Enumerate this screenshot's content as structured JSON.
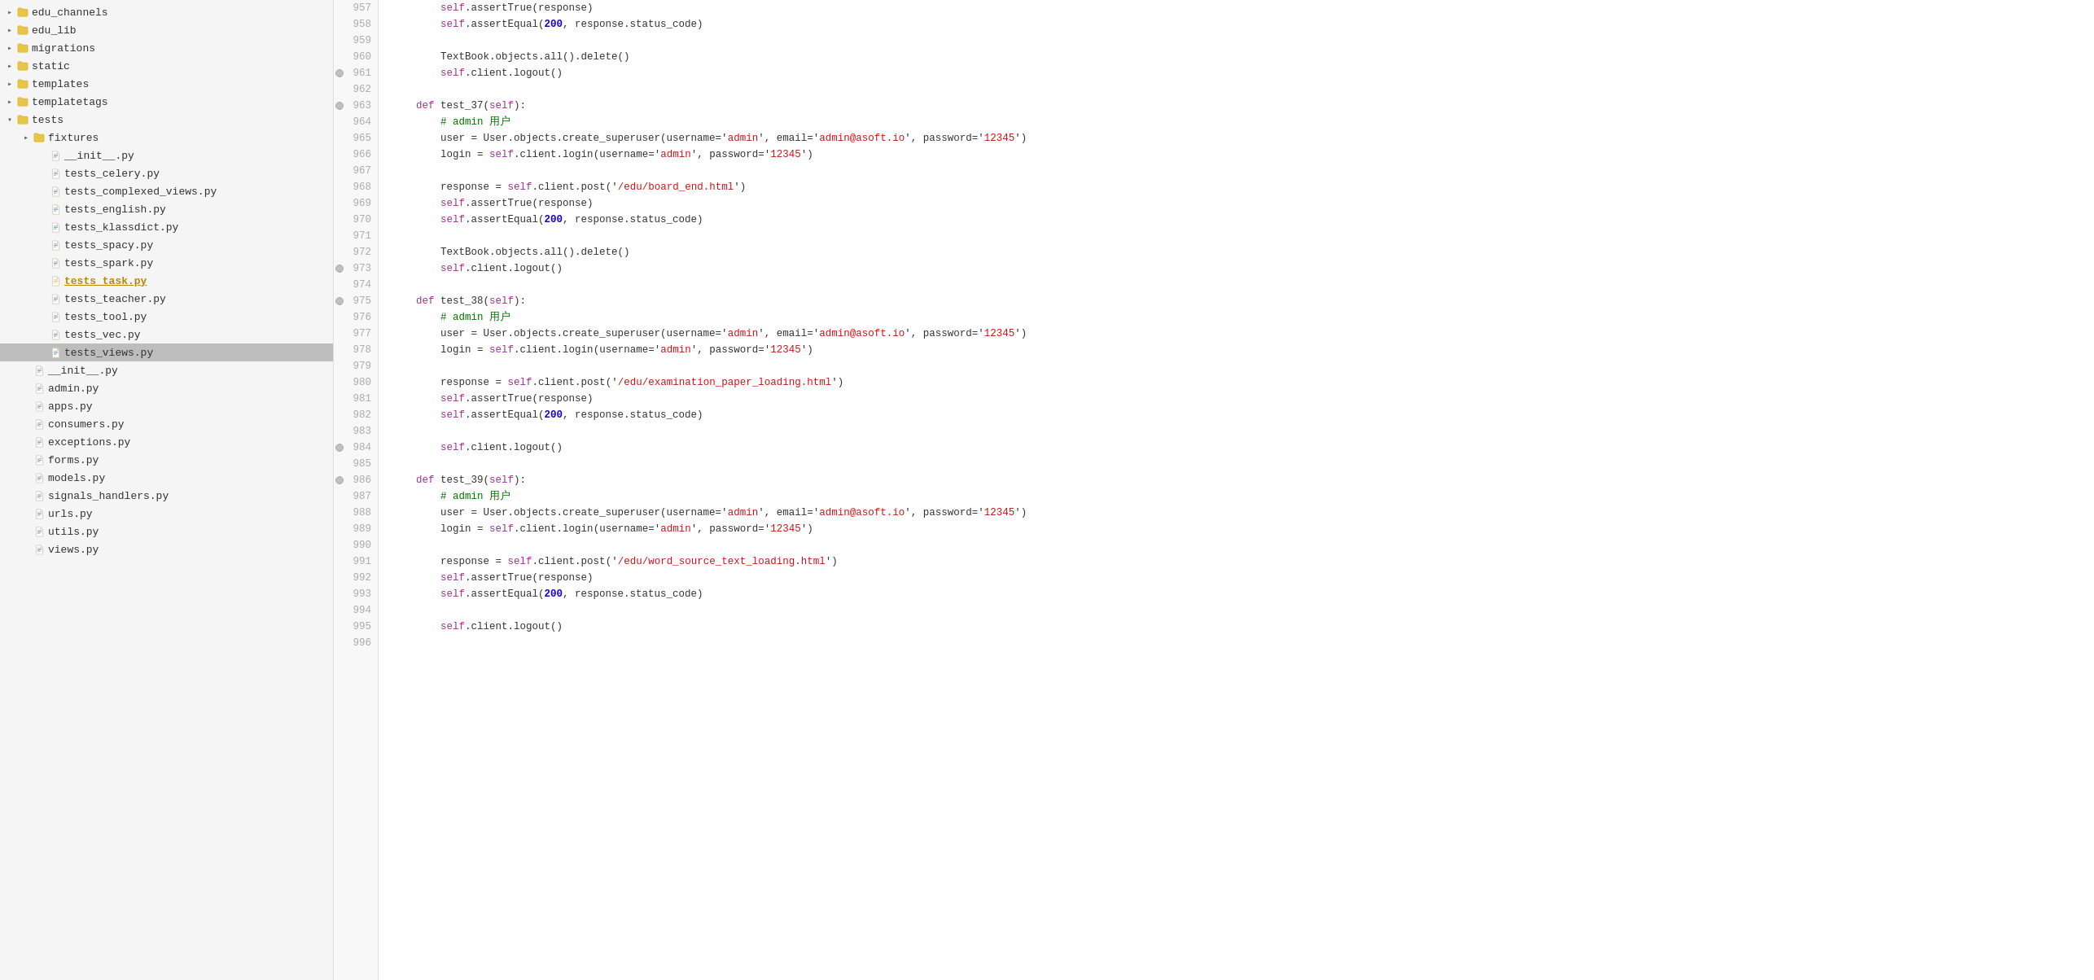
{
  "sidebar": {
    "items": [
      {
        "id": "edu_channels",
        "label": "edu_channels",
        "type": "folder",
        "indent": 1,
        "collapsed": true,
        "expanded": false
      },
      {
        "id": "edu_lib",
        "label": "edu_lib",
        "type": "folder",
        "indent": 1,
        "collapsed": true,
        "expanded": false
      },
      {
        "id": "migrations",
        "label": "migrations",
        "type": "folder",
        "indent": 1,
        "collapsed": true,
        "expanded": false
      },
      {
        "id": "static",
        "label": "static",
        "type": "folder",
        "indent": 1,
        "collapsed": true,
        "expanded": false
      },
      {
        "id": "templates",
        "label": "templates",
        "type": "folder",
        "indent": 1,
        "collapsed": true,
        "expanded": false
      },
      {
        "id": "templatetags",
        "label": "templatetags",
        "type": "folder",
        "indent": 1,
        "collapsed": true,
        "expanded": false
      },
      {
        "id": "tests",
        "label": "tests",
        "type": "folder",
        "indent": 1,
        "collapsed": false,
        "expanded": true
      },
      {
        "id": "fixtures",
        "label": "fixtures",
        "type": "folder",
        "indent": 2,
        "collapsed": true,
        "expanded": false
      },
      {
        "id": "__init__1.py",
        "label": "__init__.py",
        "type": "file",
        "indent": 3,
        "selected": false
      },
      {
        "id": "tests_celery.py",
        "label": "tests_celery.py",
        "type": "file",
        "indent": 3,
        "selected": false
      },
      {
        "id": "tests_complexed_views.py",
        "label": "tests_complexed_views.py",
        "type": "file",
        "indent": 3,
        "selected": false
      },
      {
        "id": "tests_english.py",
        "label": "tests_english.py",
        "type": "file",
        "indent": 3,
        "selected": false
      },
      {
        "id": "tests_klassdict.py",
        "label": "tests_klassdict.py",
        "type": "file",
        "indent": 3,
        "selected": false
      },
      {
        "id": "tests_spacy.py",
        "label": "tests_spacy.py",
        "type": "file",
        "indent": 3,
        "selected": false
      },
      {
        "id": "tests_spark.py",
        "label": "tests_spark.py",
        "type": "file",
        "indent": 3,
        "selected": false
      },
      {
        "id": "tests_task.py",
        "label": "tests_task.py",
        "type": "file",
        "indent": 3,
        "selected": false,
        "highlighted": true
      },
      {
        "id": "tests_teacher.py",
        "label": "tests_teacher.py",
        "type": "file",
        "indent": 3,
        "selected": false
      },
      {
        "id": "tests_tool.py",
        "label": "tests_tool.py",
        "type": "file",
        "indent": 3,
        "selected": false
      },
      {
        "id": "tests_vec.py",
        "label": "tests_vec.py",
        "type": "file",
        "indent": 3,
        "selected": false
      },
      {
        "id": "tests_views.py",
        "label": "tests_views.py",
        "type": "file",
        "indent": 3,
        "selected": true
      },
      {
        "id": "__init__2.py",
        "label": "__init__.py",
        "type": "file",
        "indent": 2,
        "selected": false
      },
      {
        "id": "admin.py",
        "label": "admin.py",
        "type": "file",
        "indent": 2,
        "selected": false
      },
      {
        "id": "apps.py",
        "label": "apps.py",
        "type": "file",
        "indent": 2,
        "selected": false
      },
      {
        "id": "consumers.py",
        "label": "consumers.py",
        "type": "file",
        "indent": 2,
        "selected": false
      },
      {
        "id": "exceptions.py",
        "label": "exceptions.py",
        "type": "file",
        "indent": 2,
        "selected": false
      },
      {
        "id": "forms.py",
        "label": "forms.py",
        "type": "file",
        "indent": 2,
        "selected": false
      },
      {
        "id": "models.py",
        "label": "models.py",
        "type": "file",
        "indent": 2,
        "selected": false
      },
      {
        "id": "signals_handlers.py",
        "label": "signals_handlers.py",
        "type": "file",
        "indent": 2,
        "selected": false
      },
      {
        "id": "urls.py",
        "label": "urls.py",
        "type": "file",
        "indent": 2,
        "selected": false
      },
      {
        "id": "utils.py",
        "label": "utils.py",
        "type": "file",
        "indent": 2,
        "selected": false
      },
      {
        "id": "views.py",
        "label": "views.py",
        "type": "file",
        "indent": 2,
        "selected": false
      }
    ]
  },
  "editor": {
    "lines": [
      {
        "num": 957,
        "content": "self.assertTrue(response)",
        "indent": 3,
        "breakpoint": false
      },
      {
        "num": 958,
        "content": "self.assertEqual(200, response.status_code)",
        "indent": 3,
        "breakpoint": false
      },
      {
        "num": 959,
        "content": "",
        "indent": 0,
        "breakpoint": false
      },
      {
        "num": 960,
        "content": "TextBook.objects.all().delete()",
        "indent": 3,
        "breakpoint": false
      },
      {
        "num": 961,
        "content": "self.client.logout()",
        "indent": 3,
        "breakpoint": true
      },
      {
        "num": 962,
        "content": "",
        "indent": 0,
        "breakpoint": false
      },
      {
        "num": 963,
        "content": "def test_37(self):",
        "indent": 2,
        "breakpoint": true
      },
      {
        "num": 964,
        "content": "# admin 用户",
        "indent": 3,
        "breakpoint": false
      },
      {
        "num": 965,
        "content": "user = User.objects.create_superuser(username='admin', email='admin@asoft.io', password='12345')",
        "indent": 3,
        "breakpoint": false
      },
      {
        "num": 966,
        "content": "login = self.client.login(username='admin', password='12345')",
        "indent": 3,
        "breakpoint": false
      },
      {
        "num": 967,
        "content": "",
        "indent": 0,
        "breakpoint": false
      },
      {
        "num": 968,
        "content": "response = self.client.post('/edu/board_end.html')",
        "indent": 3,
        "breakpoint": false
      },
      {
        "num": 969,
        "content": "self.assertTrue(response)",
        "indent": 3,
        "breakpoint": false
      },
      {
        "num": 970,
        "content": "self.assertEqual(200, response.status_code)",
        "indent": 3,
        "breakpoint": false
      },
      {
        "num": 971,
        "content": "",
        "indent": 0,
        "breakpoint": false
      },
      {
        "num": 972,
        "content": "TextBook.objects.all().delete()",
        "indent": 3,
        "breakpoint": false
      },
      {
        "num": 973,
        "content": "self.client.logout()",
        "indent": 3,
        "breakpoint": true
      },
      {
        "num": 974,
        "content": "",
        "indent": 0,
        "breakpoint": false
      },
      {
        "num": 975,
        "content": "def test_38(self):",
        "indent": 2,
        "breakpoint": true
      },
      {
        "num": 976,
        "content": "# admin 用户",
        "indent": 3,
        "breakpoint": false
      },
      {
        "num": 977,
        "content": "user = User.objects.create_superuser(username='admin', email='admin@asoft.io', password='12345')",
        "indent": 3,
        "breakpoint": false
      },
      {
        "num": 978,
        "content": "login = self.client.login(username='admin', password='12345')",
        "indent": 3,
        "breakpoint": false
      },
      {
        "num": 979,
        "content": "",
        "indent": 0,
        "breakpoint": false
      },
      {
        "num": 980,
        "content": "response = self.client.post('/edu/examination_paper_loading.html')",
        "indent": 3,
        "breakpoint": false
      },
      {
        "num": 981,
        "content": "self.assertTrue(response)",
        "indent": 3,
        "breakpoint": false
      },
      {
        "num": 982,
        "content": "self.assertEqual(200, response.status_code)",
        "indent": 3,
        "breakpoint": false
      },
      {
        "num": 983,
        "content": "",
        "indent": 0,
        "breakpoint": false
      },
      {
        "num": 984,
        "content": "self.client.logout()",
        "indent": 3,
        "breakpoint": true
      },
      {
        "num": 985,
        "content": "",
        "indent": 0,
        "breakpoint": false
      },
      {
        "num": 986,
        "content": "def test_39(self):",
        "indent": 2,
        "breakpoint": true
      },
      {
        "num": 987,
        "content": "# admin 用户",
        "indent": 3,
        "breakpoint": false
      },
      {
        "num": 988,
        "content": "user = User.objects.create_superuser(username='admin', email='admin@asoft.io', password='12345')",
        "indent": 3,
        "breakpoint": false
      },
      {
        "num": 989,
        "content": "login = self.client.login(username='admin', password='12345')",
        "indent": 3,
        "breakpoint": false
      },
      {
        "num": 990,
        "content": "",
        "indent": 0,
        "breakpoint": false
      },
      {
        "num": 991,
        "content": "response = self.client.post('/edu/word_source_text_loading.html')",
        "indent": 3,
        "breakpoint": false
      },
      {
        "num": 992,
        "content": "self.assertTrue(response)",
        "indent": 3,
        "breakpoint": false
      },
      {
        "num": 993,
        "content": "self.assertEqual(200, response.status_code)",
        "indent": 3,
        "breakpoint": false
      },
      {
        "num": 994,
        "content": "",
        "indent": 0,
        "breakpoint": false
      },
      {
        "num": 995,
        "content": "self.client.logout()",
        "indent": 3,
        "breakpoint": false
      },
      {
        "num": 996,
        "content": "",
        "indent": 0,
        "breakpoint": false
      }
    ]
  }
}
